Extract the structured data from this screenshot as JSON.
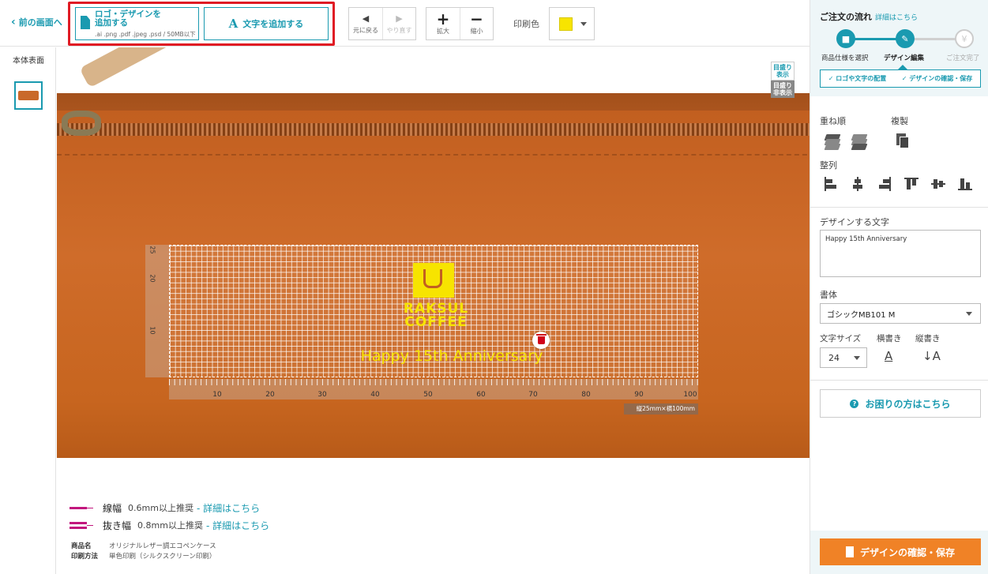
{
  "toolbar": {
    "back_label": "前の画面へ",
    "add_logo_label": "ロゴ・デザインを 追加する",
    "add_logo_sub": ".ai .png .pdf .jpeg .psd / 50MB以下",
    "add_text_label": "文字を追加する",
    "undo_label": "元に戻る",
    "redo_label": "やり直す",
    "zoom_in_label": "拡大",
    "zoom_out_label": "縮小",
    "print_color_label": "印刷色",
    "print_color": "#f7e400"
  },
  "left": {
    "side_label": "本体表面"
  },
  "canvas": {
    "guide_show": "目盛り表示",
    "guide_hide": "目盛り非表示",
    "ruler_left": [
      "25",
      "20",
      "10"
    ],
    "ruler_bottom": [
      "10",
      "20",
      "30",
      "40",
      "50",
      "60",
      "70",
      "80",
      "90",
      "100"
    ],
    "size_tag": "縦25mm×横100mm",
    "logo_line1": "RAKSUL",
    "logo_line2": "COFFEE",
    "anniv_text": "Happy 15th Anniversary"
  },
  "notes": {
    "line_width_label": "線幅",
    "line_width_desc": "0.6mm以上推奨",
    "line_width_link": "- 詳細はこちら",
    "knockout_label": "抜き幅",
    "knockout_desc": "0.8mm以上推奨",
    "knockout_link": "- 詳細はこちら",
    "product_key": "商品名",
    "product_value": "オリジナルレザー調エコペンケース",
    "method_key": "印刷方法",
    "method_value": "単色印刷（シルクスクリーン印刷）"
  },
  "panel": {
    "flow_title": "ご注文の流れ",
    "flow_link": "詳細はこちら",
    "step1": "商品仕様を選択",
    "step2": "デザイン編集",
    "step3": "ご注文完了",
    "sub1": "✓ ロゴや文字の配置",
    "sub2": "✓ デザインの確認・保存",
    "order_label": "重ね順",
    "copy_label": "複製",
    "align_label": "整列",
    "design_text_label": "デザインする文字",
    "design_text_value": "Happy 15th Anniversary",
    "font_label": "書体",
    "font_value": "ゴシックMB101 M",
    "size_label": "文字サイズ",
    "size_value": "24",
    "horizontal_label": "横書き",
    "vertical_label": "縦書き",
    "help_label": "お困りの方はこちら",
    "confirm_label": "デザインの確認・保存"
  }
}
